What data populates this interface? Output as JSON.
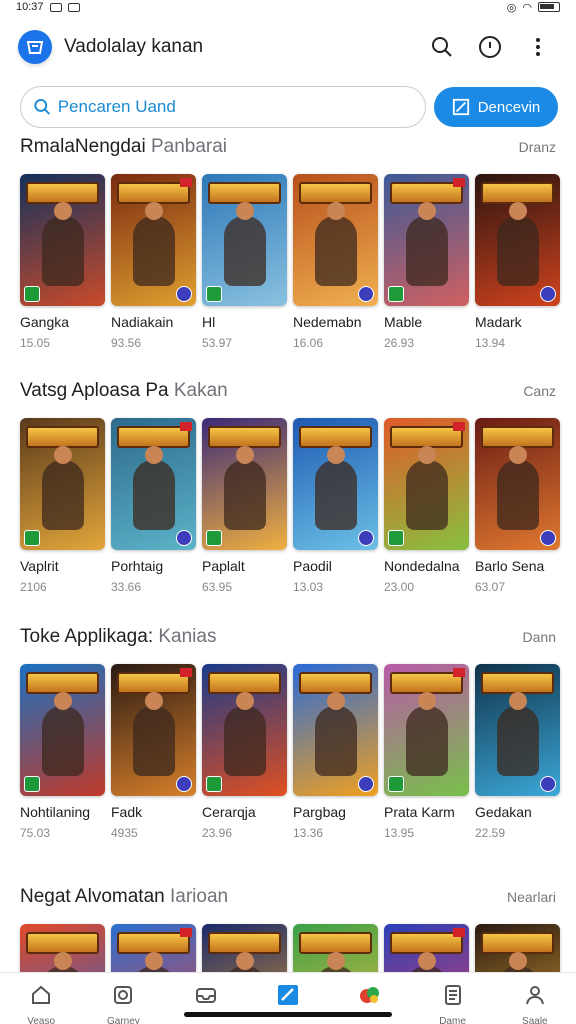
{
  "status_bar": {
    "time": "10:37",
    "left_icons": [
      "image-icon",
      "sync-icon"
    ],
    "right_icons": [
      "cast-icon",
      "wifi-icon",
      "battery-icon"
    ]
  },
  "header": {
    "title": "Vadolalay kanan",
    "icons": [
      "search-icon",
      "timer-icon",
      "more-vert-icon"
    ]
  },
  "search": {
    "placeholder": "Pencaren Uand",
    "button_label": "Dencevin"
  },
  "sections": [
    {
      "title": "RmalaNengdai",
      "title_muted": "Panbarai",
      "more": "Dranz",
      "items": [
        {
          "name": "Gangka",
          "meta": "15.05",
          "palette": [
            "#13315c",
            "#c94b2a"
          ]
        },
        {
          "name": "Nadiakain",
          "meta": "93.56",
          "palette": [
            "#7a2a10",
            "#e0a030"
          ]
        },
        {
          "name": "Hl",
          "meta": "53.97",
          "palette": [
            "#2d78b8",
            "#8ac2e0"
          ]
        },
        {
          "name": "Nedemabn",
          "meta": "16.06",
          "palette": [
            "#b8501c",
            "#f0b050"
          ]
        },
        {
          "name": "Mable",
          "meta": "26.93",
          "palette": [
            "#3c5a98",
            "#d06060"
          ]
        },
        {
          "name": "Madark",
          "meta": "13.94",
          "palette": [
            "#2a1410",
            "#d0431e"
          ]
        }
      ]
    },
    {
      "title": "Vatsg Aploasa Pa",
      "title_muted": "Kakan",
      "more": "Canz",
      "items": [
        {
          "name": "Vaplrit",
          "meta": "2106",
          "palette": [
            "#5a3a1c",
            "#e2a63a"
          ]
        },
        {
          "name": "Porhtaig",
          "meta": "33.66",
          "palette": [
            "#2c6a8c",
            "#5cb3c8"
          ]
        },
        {
          "name": "Paplalt",
          "meta": "63.95",
          "palette": [
            "#3b2a78",
            "#f0b040"
          ]
        },
        {
          "name": "Paodil",
          "meta": "13.03",
          "palette": [
            "#1e5ab2",
            "#6cc0e6"
          ]
        },
        {
          "name": "Nondedalna",
          "meta": "23.00",
          "palette": [
            "#e05a2a",
            "#88c040"
          ]
        },
        {
          "name": "Barlo Sena",
          "meta": "63.07",
          "palette": [
            "#6a1c14",
            "#e07830"
          ]
        }
      ]
    },
    {
      "title": "Toke Applikaga:",
      "title_muted": "Kanias",
      "more": "Dann",
      "items": [
        {
          "name": "Nohtilaning",
          "meta": "75.03",
          "palette": [
            "#1a70c0",
            "#c03a2a"
          ]
        },
        {
          "name": "Fadk",
          "meta": "4935",
          "palette": [
            "#2a1a14",
            "#d8802a"
          ]
        },
        {
          "name": "Cerarqja",
          "meta": "23.96",
          "palette": [
            "#1a3a8a",
            "#e05020"
          ]
        },
        {
          "name": "Pargbag",
          "meta": "13.36",
          "palette": [
            "#2a6ad8",
            "#f0a020"
          ]
        },
        {
          "name": "Prata Karm",
          "meta": "13.95",
          "palette": [
            "#b85aa8",
            "#78c04a"
          ]
        },
        {
          "name": "Gedakan",
          "meta": "22.59",
          "palette": [
            "#10324a",
            "#3ca8d8"
          ]
        }
      ]
    },
    {
      "title": "Negat Alvomatan",
      "title_muted": "Iarioan",
      "more": "Nearlari",
      "items": [
        {
          "name": "",
          "meta": "",
          "palette": [
            "#e04a2a",
            "#2a60c8"
          ]
        },
        {
          "name": "",
          "meta": "",
          "palette": [
            "#2a70d0",
            "#e04040"
          ]
        },
        {
          "name": "",
          "meta": "",
          "palette": [
            "#1a2a6a",
            "#e09a30"
          ]
        },
        {
          "name": "",
          "meta": "",
          "palette": [
            "#3aa048",
            "#f0c040"
          ]
        },
        {
          "name": "",
          "meta": "",
          "palette": [
            "#2a40b8",
            "#e04060"
          ]
        },
        {
          "name": "",
          "meta": "",
          "palette": [
            "#2a1a14",
            "#d8a030"
          ]
        }
      ]
    }
  ],
  "bottom_nav": [
    {
      "label": "Veaso",
      "icon": "home-icon"
    },
    {
      "label": "Garney",
      "icon": "badge-icon"
    },
    {
      "label": "",
      "icon": "inbox-icon"
    },
    {
      "label": "",
      "icon": "edit-icon"
    },
    {
      "label": "",
      "icon": "games-logo-icon"
    },
    {
      "label": "Dame",
      "icon": "document-icon"
    },
    {
      "label": "Saale",
      "icon": "person-icon"
    }
  ],
  "colors": {
    "accent": "#1a8ae4",
    "text": "#202124",
    "muted": "#888888"
  }
}
